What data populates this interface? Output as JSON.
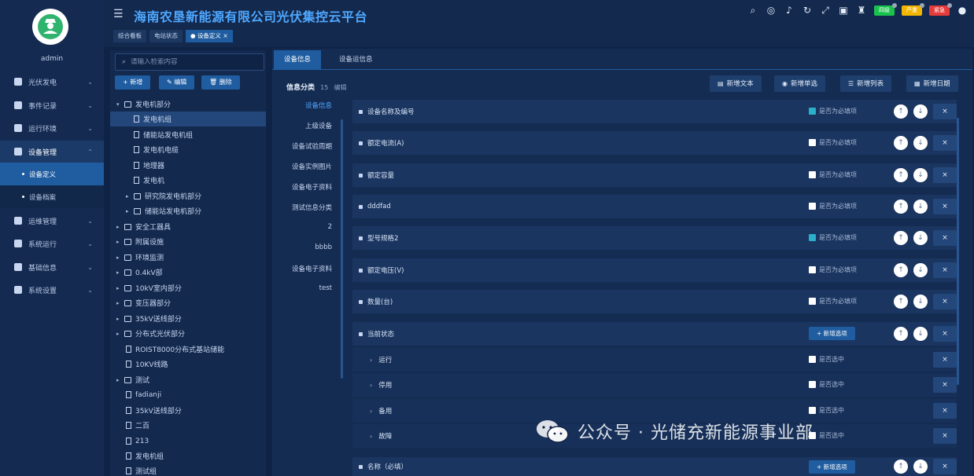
{
  "app": {
    "title": "海南农垦新能源有限公司光伏集控云平台",
    "user_name": "admin"
  },
  "nav": {
    "items": [
      {
        "label": "光伏发电",
        "icon": "chart-icon"
      },
      {
        "label": "事件记录",
        "icon": "record-icon"
      },
      {
        "label": "运行环境",
        "icon": "env-icon"
      },
      {
        "label": "设备管理",
        "icon": "device-icon"
      },
      {
        "label": "运维管理",
        "icon": "ops-icon"
      },
      {
        "label": "系统运行",
        "icon": "run-icon"
      },
      {
        "label": "基础信息",
        "icon": "info-icon"
      },
      {
        "label": "系统设置",
        "icon": "settings-icon"
      }
    ],
    "sub_items": [
      "设备定义",
      "设备档案"
    ]
  },
  "header": {
    "badges": [
      {
        "label": "四级",
        "color": "#19c24d"
      },
      {
        "label": "严重",
        "color": "#f2b600"
      },
      {
        "label": "紧急",
        "color": "#e63b3b"
      }
    ],
    "tabs": [
      "综合看板",
      "电站状态",
      "设备定义"
    ]
  },
  "tree": {
    "search_placeholder": "请输入检索内容",
    "buttons": {
      "add": "新增",
      "edit": "编辑",
      "delete": "删除"
    },
    "rows": [
      "发电机部分",
      "发电机组",
      "储能站发电机组",
      "发电机电缆",
      "地理器",
      "发电机",
      "研究院发电机部分",
      "储能站发电机部分",
      "安全工器具",
      "附属设施",
      "环境监测",
      "0.4kV部",
      "10kV室内部分",
      "变压器部分",
      "35kV送线部分",
      "分布式光伏部分",
      "ROIST8000分布式基站储能",
      "10KV线路",
      "测试",
      "fadianji",
      "35kV送线部分",
      "二百",
      "213",
      "发电机组",
      "测试组"
    ]
  },
  "main": {
    "tabs": [
      "设备信息",
      "设备运信息"
    ],
    "heading": "信息分类",
    "heading_count": "15",
    "heading_edit": "编辑",
    "actions": {
      "add_text": "新增文本",
      "add_single": "新增单选",
      "add_list": "新增列表",
      "add_date": "新增日期"
    },
    "categories": [
      "设备信息",
      "上级设备",
      "设备试验周期",
      "设备实例图片",
      "设备电子资料",
      "测试信息分类",
      "2",
      "bbbb",
      "设备电子资料",
      "test"
    ],
    "fields": [
      {
        "name": "设备名称及编号",
        "check_label": "是否为必填项"
      },
      {
        "name": "额定电流(A)",
        "check_label": "是否为必填项"
      },
      {
        "name": "额定容量",
        "check_label": "是否为必填项"
      },
      {
        "name": "dddfad",
        "check_label": "是否为必填项"
      },
      {
        "name": "型号规格2",
        "check_label": "是否为必填项"
      },
      {
        "name": "额定电压(V)",
        "check_label": "是否为必填项"
      },
      {
        "name": "数量(台)",
        "check_label": "是否为必填项"
      },
      {
        "name": "当前状态",
        "add_label": "新增选项"
      }
    ],
    "options": [
      {
        "name": "运行",
        "check_label": "是否选中"
      },
      {
        "name": "停用",
        "check_label": "是否选中"
      },
      {
        "name": "备用",
        "check_label": "是否选中"
      },
      {
        "name": "故障",
        "check_label": "是否选中"
      }
    ],
    "last_field": {
      "name": "名称（必填）",
      "add_label": "新增选项"
    }
  },
  "watermark": "公众号 · 光储充新能源事业部"
}
